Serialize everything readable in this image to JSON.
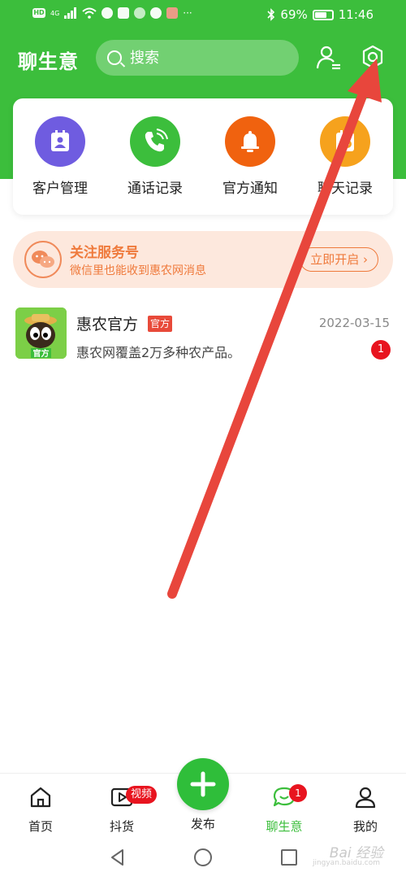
{
  "status_bar": {
    "hd_label": "HD",
    "network_label": "4G",
    "battery_text": "69%",
    "time": "11:46"
  },
  "header": {
    "title": "聊生意",
    "search_placeholder": "搜索"
  },
  "quick_actions": [
    {
      "label": "客户管理",
      "icon": "contact-card-icon",
      "color": "#6f5ce0"
    },
    {
      "label": "通话记录",
      "icon": "phone-call-icon",
      "color": "#3cbe3c"
    },
    {
      "label": "官方通知",
      "icon": "bell-icon",
      "color": "#f0620f"
    },
    {
      "label": "聊天记录",
      "icon": "chat-history-icon",
      "color": "#f6a21d"
    }
  ],
  "follow_banner": {
    "title": "关注服务号",
    "subtitle": "微信里也能收到惠农网消息",
    "button_label": "立即开启"
  },
  "messages": [
    {
      "name": "惠农官方",
      "tag": "官方",
      "avatar_label": "官方",
      "date": "2022-03-15",
      "preview": "惠农网覆盖2万多种农产品。",
      "unread": "1"
    }
  ],
  "bottom_nav": {
    "items": [
      {
        "label": "首页"
      },
      {
        "label": "抖货",
        "badge": "视频"
      },
      {
        "label": "发布"
      },
      {
        "label": "聊生意",
        "badge": "1",
        "active": true
      },
      {
        "label": "我的"
      }
    ]
  },
  "watermark": {
    "text": "Bai 经验",
    "sub": "jingyan.baidu.com"
  },
  "colors": {
    "brand_green": "#3cbe3c",
    "accent_orange": "#ef7a3c",
    "badge_red": "#e8141f",
    "annotation_arrow": "#e8463c"
  }
}
